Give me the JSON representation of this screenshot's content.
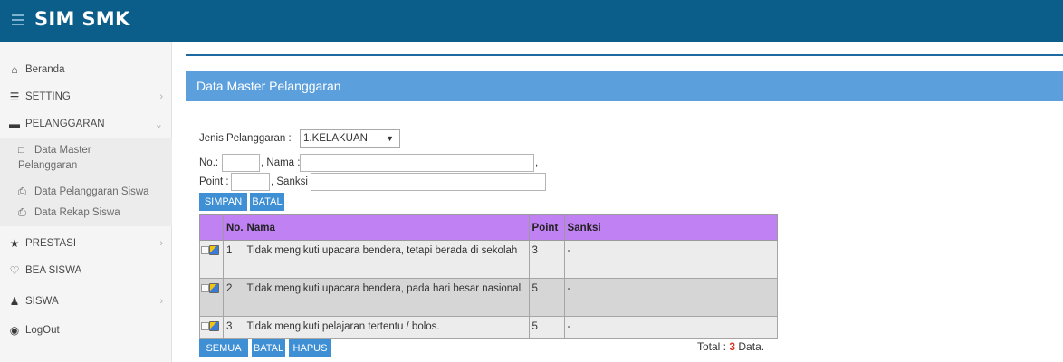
{
  "app": {
    "brand": "SIM SMK"
  },
  "sidebar": {
    "items": [
      {
        "label": "Beranda",
        "icon": "home-icon"
      },
      {
        "label": "SETTING",
        "icon": "list-icon"
      },
      {
        "label": "PELANGGARAN",
        "icon": "minus-square-icon"
      },
      {
        "label": "PRESTASI",
        "icon": "star-icon"
      },
      {
        "label": "BEA SISWA",
        "icon": "heart-icon"
      },
      {
        "label": "SISWA",
        "icon": "users-icon"
      },
      {
        "label": "LogOut",
        "icon": "power-icon"
      }
    ],
    "subitems": [
      {
        "label_line1": "Data Master",
        "label_line2": "Pelanggaran",
        "icon": "folder-icon"
      },
      {
        "label": "Data Pelanggaran Siswa",
        "icon": "print-icon"
      },
      {
        "label": "Data Rekap Siswa",
        "icon": "print-icon"
      }
    ]
  },
  "page": {
    "title": "Data Master Pelanggaran"
  },
  "form": {
    "jenis_label": "Jenis Pelanggaran :",
    "jenis_value": "1.KELAKUAN",
    "no_label": "No.:",
    "nama_label": ", Nama :",
    "trailing_comma": ",",
    "point_label": "Point :",
    "sanksi_label": ", Sanksi :",
    "simpan_label": "SIMPAN",
    "batal_label": "BATAL"
  },
  "table": {
    "headers": {
      "no": "No.",
      "nama": "Nama",
      "point": "Point",
      "sanksi": "Sanksi"
    },
    "rows": [
      {
        "no": "1",
        "nama": "Tidak mengikuti upacara bendera, tetapi berada di sekolah",
        "point": "3",
        "sanksi": "-"
      },
      {
        "no": "2",
        "nama": "Tidak mengikuti upacara bendera, pada hari besar nasional.",
        "point": "5",
        "sanksi": "-"
      },
      {
        "no": "3",
        "nama": "Tidak mengikuti pelajaran tertentu / bolos.",
        "point": "5",
        "sanksi": "-"
      }
    ]
  },
  "footer": {
    "semua_label": "SEMUA",
    "batal_label": "BATAL",
    "hapus_label": "HAPUS",
    "total_prefix": "Total :",
    "total_count": "3",
    "total_suffix": "Data."
  },
  "colors": {
    "topbar": "#0b5e8a",
    "header": "#5b9fdd",
    "table_header": "#c082f3",
    "button": "#3e8fd4",
    "total_count": "#d9301f"
  }
}
